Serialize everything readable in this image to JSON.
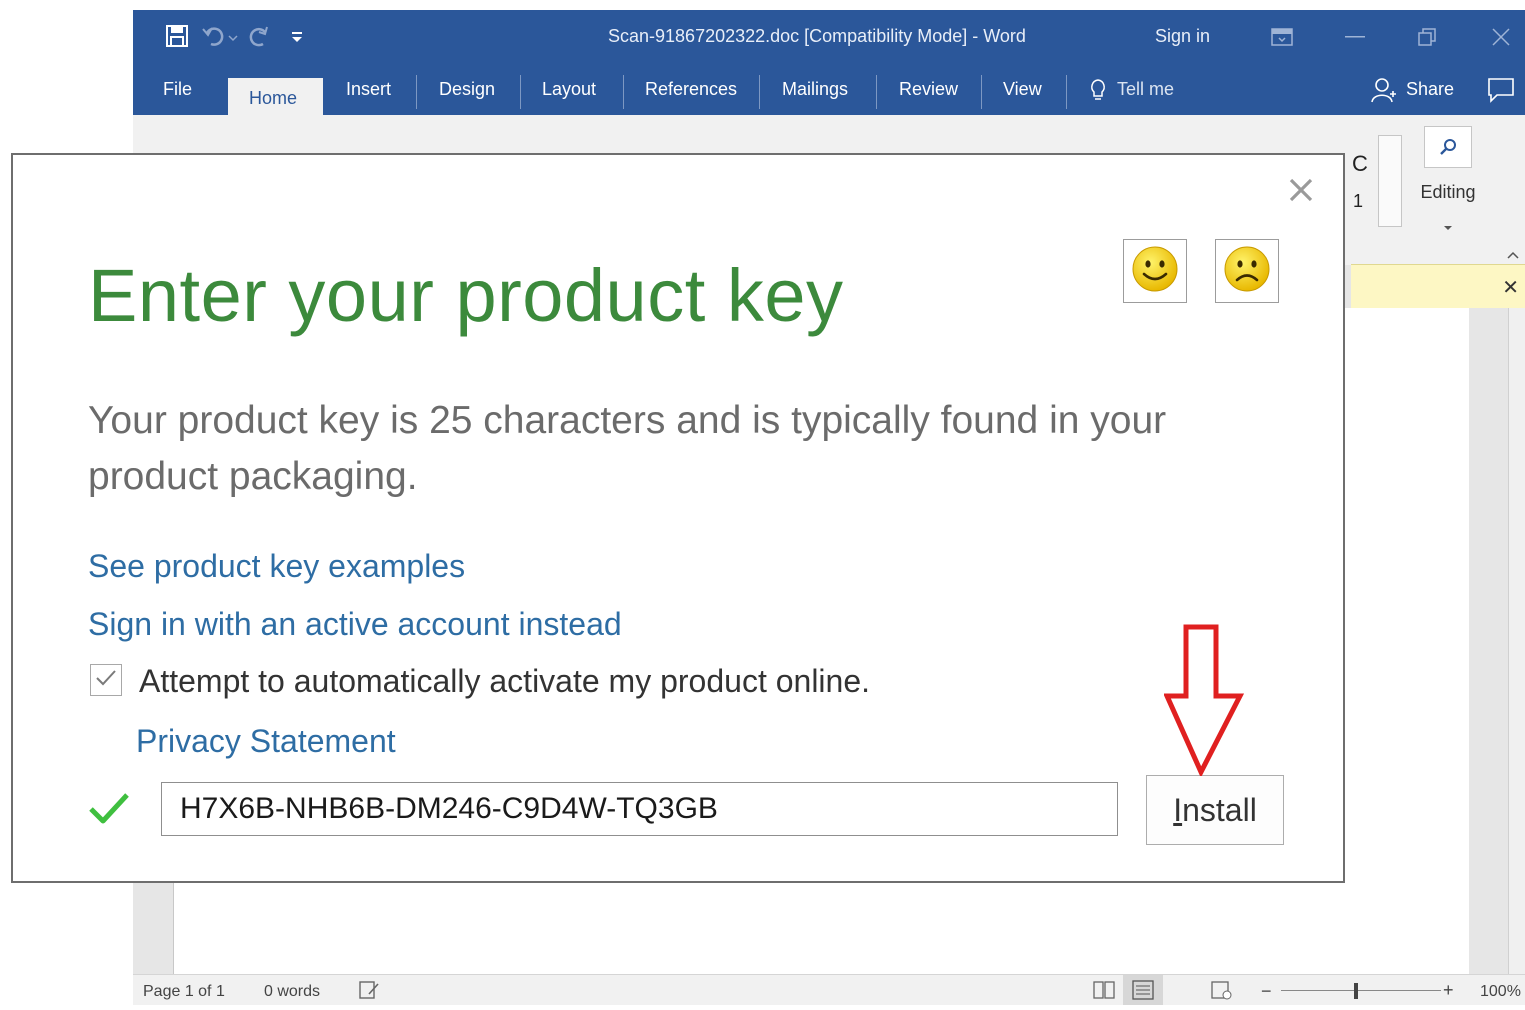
{
  "word": {
    "title": "Scan-91867202322.doc [Compatibility Mode]  -  Word",
    "sign_in": "Sign in",
    "tabs": {
      "file": "File",
      "home": "Home",
      "insert": "Insert",
      "design": "Design",
      "layout": "Layout",
      "references": "References",
      "mailings": "Mailings",
      "review": "Review",
      "view": "View",
      "tell_me": "Tell me",
      "share": "Share"
    },
    "ribbon": {
      "editing_label": "Editing",
      "styles_partial_c": "C",
      "styles_partial_1": "1"
    },
    "status": {
      "page": "Page 1 of 1",
      "words": "0 words",
      "zoom": "100%"
    }
  },
  "dialog": {
    "title": "Enter your product key",
    "description": "Your product key is 25 characters and is typically found in your product packaging.",
    "link_examples": "See product key examples",
    "link_signin": "Sign in with an active account instead",
    "checkbox_label": "Attempt to automatically activate my product online.",
    "checkbox_checked": true,
    "link_privacy": "Privacy Statement",
    "product_key": "H7X6B-NHB6B-DM246-C9D4W-TQ3GB",
    "install_label_rest": "nstall",
    "install_label_accel": "I",
    "colors": {
      "title_green": "#3c8a3c",
      "link_blue": "#2e6da4",
      "arrow_red": "#e02020",
      "word_blue": "#2b579a"
    }
  },
  "icons": [
    "save-icon",
    "undo-icon",
    "redo-icon",
    "customize-qat-icon",
    "ribbon-display-icon",
    "minimize-icon",
    "restore-icon",
    "close-icon",
    "lightbulb-icon",
    "share-person-icon",
    "comments-icon",
    "search-icon",
    "smiley-happy-icon",
    "smiley-sad-icon",
    "dialog-close-icon",
    "checkmark-icon",
    "valid-check-icon",
    "red-arrow-icon"
  ]
}
